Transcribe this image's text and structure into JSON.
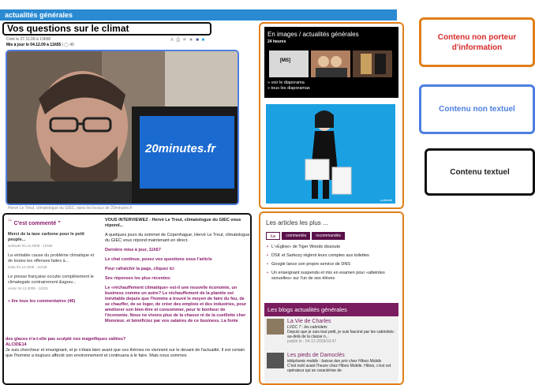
{
  "header": {
    "section": "actualités générales"
  },
  "article": {
    "title": "Vos questions sur le climat",
    "created": "Créé le 27.11.09 à 13h58",
    "updated": "Mis à jour le 04.12.09 à 11h55",
    "comment_count": "46",
    "photo_caption": "Hervé Le Treut, climatologue du GIEC, dans les locaux de 20minutes.fr",
    "screen_brand": "20minutes.fr"
  },
  "comments": {
    "title": "C'est commenté",
    "items": [
      {
        "text": "Merci de la taxe carbone pour le petit peuple...",
        "author": "wahwah 04.12.2009 - 11h55"
      },
      {
        "text": "La véritable cause du problème climatique et de toutes les offenses faites à...",
        "author": "Gala 04.12.2009 - 11h38"
      },
      {
        "text": "Le presse française occulte complètement le climategate contrairement &agrav...",
        "author": "oscar 04.12.2009 - 11h31"
      }
    ],
    "read_all": "» lire tous les commentaires (46)"
  },
  "interview": {
    "heading": "VOUS INTERVIEWEZ - Hervé Le Treut, climatologue du GIEC vous répond...",
    "intro": "A quelques jours du sommet de Copenhague, Hervé Le Treut, climatologue du GIEC vous répond maintenant en direct.",
    "last_update": "Dernière mise à jour, 11h57",
    "continue": "Le chat continue, posez vos questions sous l'article",
    "refresh": "Pour rafraîchir la page, cliquez ici",
    "answers_title": "Ses réponses les plus récentes:",
    "q1": "Le «réchauffement climatique» est-il une nouvelle économie, un business comme un autre? Le réchauffement de la planète est inévitable depuis que l'homme a trouvé le moyen de faire du feu, de se chauffer, de se loger, de créer des emplois et des industries, pour améliorer son bien-être et consommer, pour le bonheur de l'économie. Nous ne vivons plus de la chasse ni de la cueillette cher Monsieur, et bénéficiez par vos salaires de ce business. La fonte",
    "q2": "des glaces n'a-t-elle pas sculpté nos magnifiques vallées?",
    "author": "ALCIDE14",
    "answer_start": "Je suis chercheur et enseignant, et je n'étais bien avant que ces thèmes ne viennent sur le devant de l'actualité. Il est certain que l'homme a toujours affecté son environnement et continuera à le faire. Mais nous sommes"
  },
  "images_panel": {
    "title": "En images / actualités générales",
    "subtitle": "24 heures",
    "thumb_label": "[MS]",
    "links": [
      "» voir le diaporama",
      "» tous les diaporamas"
    ]
  },
  "ad": {
    "tag": "publicité"
  },
  "articles_plus": {
    "title": "Les articles les plus ...",
    "tabs": [
      "lus",
      "commentés",
      "recommandés"
    ],
    "items": [
      "L'«Eglise» de Tiger Woods dissoute",
      "DSK et Sarkozy règlent leurs comptes aux toilettes",
      "Google lance son propre service de DNS",
      "Un enseignant suspendu et mis en examen pour «atteintes sexuelles» sur l'un de ses élèves"
    ]
  },
  "blogs": {
    "title": "Les blogs actualités générales",
    "entries": [
      {
        "name": "La Vie de Charles",
        "sub": "LVDC 7 : les cabriolets",
        "text": "Depuis que je suis tout petit, je suis fasciné par les cabriolets : au-delà de la classe n...",
        "date": "publié le : 04-12-2009/10:47"
      },
      {
        "name": "Les pieds de Damoclès",
        "sub": "téléphonie mobile : baisse des prix chez Hiboo Mobile",
        "text": "C'est noël avant l'heure chez Hiboo Mobile. Hiboo, c'est cet opérateur qui se caractérise de"
      }
    ]
  },
  "legend": {
    "non_info": "Contenu non porteur d'information",
    "non_text": "Contenu non textuel",
    "text": "Contenu textuel"
  },
  "colors": {
    "brand_blue": "#2a8ad2",
    "magenta": "#8b1a6b",
    "orange_outline": "#e07f1a",
    "blue_outline": "#4d7fe0",
    "black_outline": "#111111"
  }
}
